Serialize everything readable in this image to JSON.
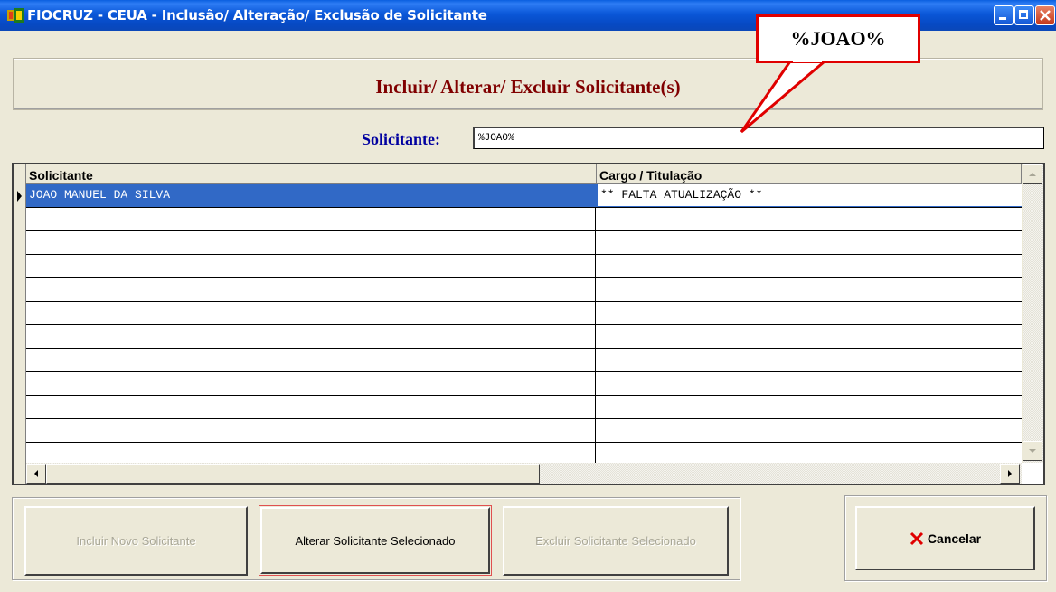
{
  "window": {
    "title": "FIOCRUZ - CEUA - Inclusão/ Alteração/ Exclusão de Solicitante"
  },
  "header": {
    "title": "Incluir/ Alterar/ Excluir Solicitante(s)"
  },
  "search": {
    "label": "Solicitante:",
    "value": "%JOAO%"
  },
  "grid": {
    "columns": [
      "Solicitante",
      "Cargo / Titulação"
    ],
    "rows": [
      [
        "JOAO MANUEL DA SILVA",
        "** FALTA ATUALIZAÇÃO **"
      ]
    ]
  },
  "buttons": {
    "include": "Incluir Novo Solicitante",
    "alter": "Alterar Solicitante Selecionado",
    "delete": "Excluir Solicitante Selecionado",
    "cancel": "Cancelar"
  },
  "callout": {
    "text": "%JOAO%"
  },
  "colors": {
    "title_bar": "#0A57D8",
    "header_text": "#800000",
    "label_text": "#0000A0",
    "selection": "#3169C6",
    "callout_border": "#E00000"
  }
}
